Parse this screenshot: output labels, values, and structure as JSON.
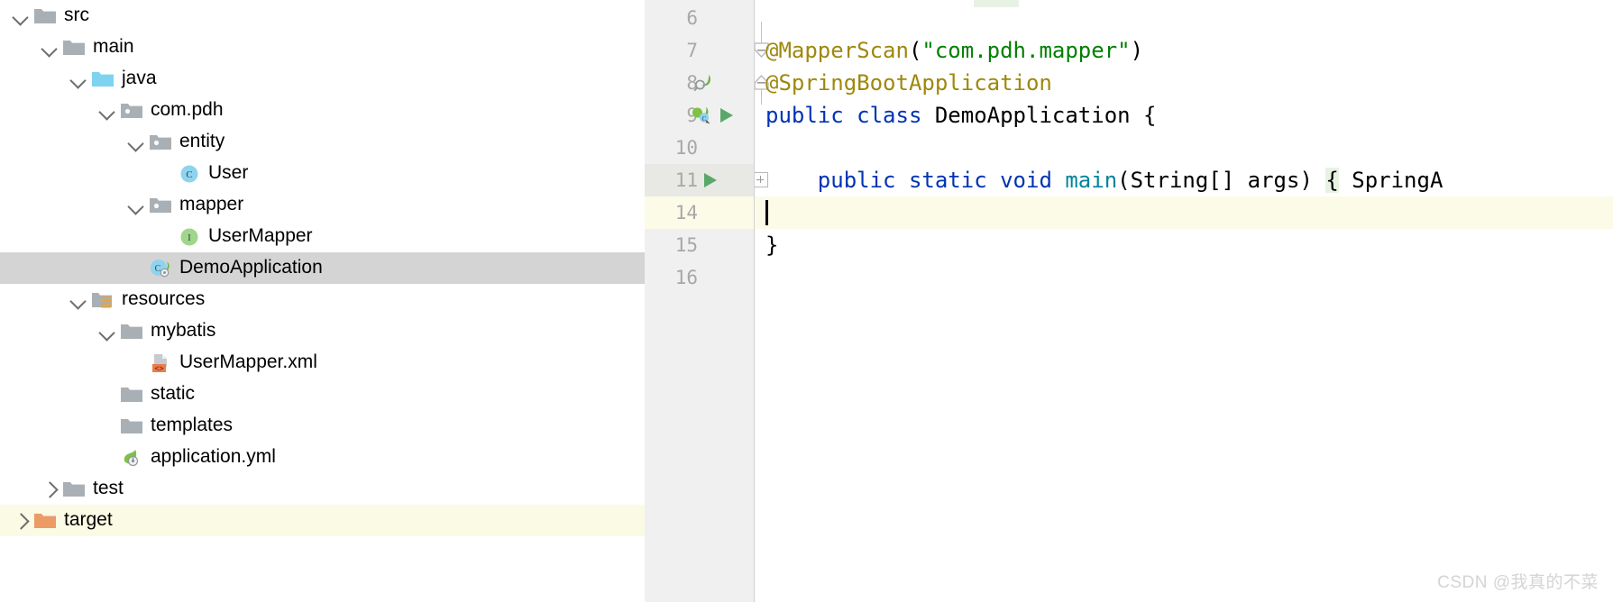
{
  "project_tree": {
    "rows": [
      {
        "label": "src",
        "indent": 0,
        "twisty": "down",
        "icon": "folder-gray",
        "state": "normal"
      },
      {
        "label": "main",
        "indent": 1,
        "twisty": "down",
        "icon": "folder-gray",
        "state": "normal"
      },
      {
        "label": "java",
        "indent": 2,
        "twisty": "down",
        "icon": "folder-sources",
        "state": "normal"
      },
      {
        "label": "com.pdh",
        "indent": 3,
        "twisty": "down",
        "icon": "folder-package",
        "state": "normal"
      },
      {
        "label": "entity",
        "indent": 4,
        "twisty": "down",
        "icon": "folder-package",
        "state": "normal"
      },
      {
        "label": "User",
        "indent": 5,
        "twisty": "none",
        "icon": "java-class",
        "state": "normal"
      },
      {
        "label": "mapper",
        "indent": 4,
        "twisty": "down",
        "icon": "folder-package",
        "state": "normal"
      },
      {
        "label": "UserMapper",
        "indent": 5,
        "twisty": "none",
        "icon": "java-interface",
        "state": "normal"
      },
      {
        "label": "DemoApplication",
        "indent": 4,
        "twisty": "none",
        "icon": "spring-boot-class",
        "state": "selected"
      },
      {
        "label": "resources",
        "indent": 2,
        "twisty": "down",
        "icon": "folder-resources",
        "state": "normal"
      },
      {
        "label": "mybatis",
        "indent": 3,
        "twisty": "down",
        "icon": "folder-gray",
        "state": "normal"
      },
      {
        "label": "UserMapper.xml",
        "indent": 4,
        "twisty": "none",
        "icon": "xml-file",
        "state": "normal"
      },
      {
        "label": "static",
        "indent": 3,
        "twisty": "none",
        "icon": "folder-gray",
        "state": "normal"
      },
      {
        "label": "templates",
        "indent": 3,
        "twisty": "none",
        "icon": "folder-gray",
        "state": "normal"
      },
      {
        "label": "application.yml",
        "indent": 3,
        "twisty": "none",
        "icon": "spring-yml",
        "state": "normal"
      },
      {
        "label": "test",
        "indent": 1,
        "twisty": "right",
        "icon": "folder-gray",
        "state": "normal"
      },
      {
        "label": "target",
        "indent": 0,
        "twisty": "right",
        "icon": "folder-orange",
        "state": "marked"
      }
    ]
  },
  "editor": {
    "lines": [
      {
        "number": "6",
        "gutter_icons": [],
        "fold": "none",
        "tokens": []
      },
      {
        "number": "7",
        "gutter_icons": [],
        "fold": "collapse-end",
        "tokens": [
          {
            "text": "@MapperScan",
            "type": "annotation"
          },
          {
            "text": "(",
            "type": "punct"
          },
          {
            "text": "\"com.pdh.mapper\"",
            "type": "string"
          },
          {
            "text": ")",
            "type": "punct"
          }
        ]
      },
      {
        "number": "8",
        "gutter_icons": [
          "spring-search-icon"
        ],
        "fold": "collapse-start",
        "tokens": [
          {
            "text": "@SpringBootApplication",
            "type": "annotation"
          }
        ]
      },
      {
        "number": "9",
        "gutter_icons": [
          "spring-bean-icon",
          "run-icon"
        ],
        "fold": "none",
        "tokens": [
          {
            "text": "public",
            "type": "keyword"
          },
          {
            "text": " ",
            "type": "punct"
          },
          {
            "text": "class",
            "type": "keyword"
          },
          {
            "text": " ",
            "type": "punct"
          },
          {
            "text": "DemoApplication",
            "type": "identifier"
          },
          {
            "text": " {",
            "type": "punct"
          }
        ]
      },
      {
        "number": "10",
        "gutter_icons": [],
        "fold": "none",
        "tokens": []
      },
      {
        "number": "11",
        "gutter_icons": [
          "run-icon"
        ],
        "fold": "expand-plus",
        "tokens": [
          {
            "text": "    ",
            "type": "punct"
          },
          {
            "text": "public",
            "type": "keyword"
          },
          {
            "text": " ",
            "type": "punct"
          },
          {
            "text": "static",
            "type": "keyword"
          },
          {
            "text": " ",
            "type": "punct"
          },
          {
            "text": "void",
            "type": "keyword"
          },
          {
            "text": " ",
            "type": "punct"
          },
          {
            "text": "main",
            "type": "method"
          },
          {
            "text": "(String[] args) ",
            "type": "punct"
          },
          {
            "text": "{",
            "type": "brace-highlight"
          },
          {
            "text": " SpringA",
            "type": "punct"
          }
        ]
      },
      {
        "number": "14",
        "gutter_icons": [],
        "fold": "none",
        "current": true,
        "tokens": []
      },
      {
        "number": "15",
        "gutter_icons": [],
        "fold": "none",
        "tokens": [
          {
            "text": "}",
            "type": "punct"
          }
        ]
      },
      {
        "number": "16",
        "gutter_icons": [],
        "fold": "none",
        "tokens": []
      }
    ]
  },
  "watermark": {
    "text": "CSDN @我真的不菜"
  },
  "colors": {
    "annotation": "#9e880d",
    "string": "#008000",
    "keyword": "#0033b3",
    "method": "#00849b",
    "selection": "#d4d4d4",
    "current_line": "#fcfbe8",
    "gutter_bg": "#f0f0f0",
    "folder_orange": "#ec9a66",
    "run_green": "#59a869"
  }
}
